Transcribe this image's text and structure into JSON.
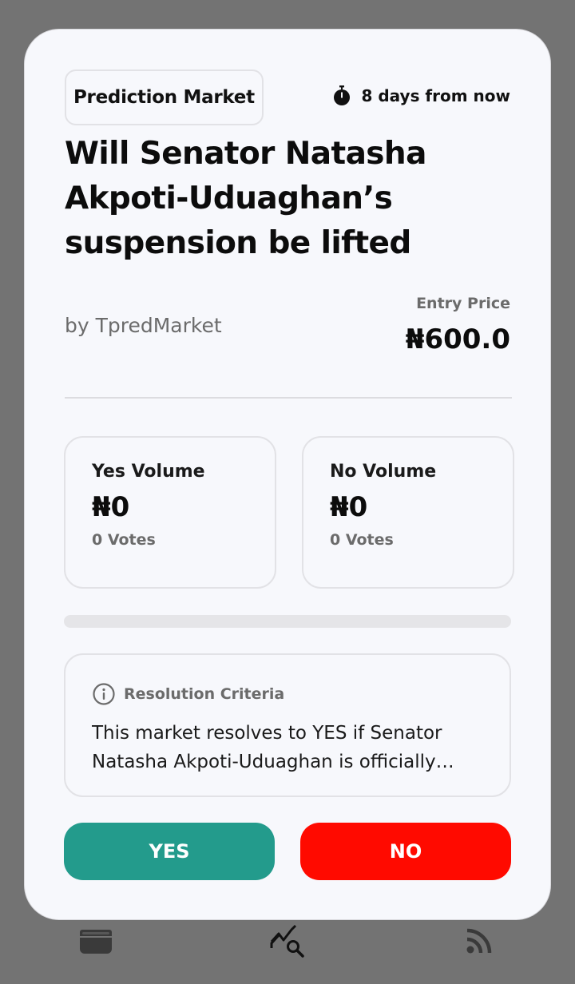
{
  "market": {
    "category": "Prediction Market",
    "deadline": "8 days from now",
    "title": "Will Senator Natasha Akpoti-Uduaghan’s suspension be lifted before",
    "author": "by TpredMarket",
    "entry_label": "Entry Price",
    "entry_value": "₦600.0"
  },
  "volumes": {
    "yes": {
      "label": "Yes Volume",
      "amount": "₦0",
      "votes": "0 Votes"
    },
    "no": {
      "label": "No Volume",
      "amount": "₦0",
      "votes": "0 Votes"
    }
  },
  "progress": {
    "yes_fraction": 0
  },
  "criteria": {
    "label": "Resolution Criteria",
    "text": "This market resolves to YES if Senator Natasha Akpoti-Uduaghan is officially reinstated to the Senate before the deadline."
  },
  "actions": {
    "yes_label": "YES",
    "no_label": "NO"
  },
  "nav": {
    "items": [
      "wallet-icon",
      "market-analysis-icon",
      "rss-feed-icon"
    ]
  },
  "colors": {
    "yes": "#239b8c",
    "no": "#ff0a00",
    "background": "#737373",
    "card": "#f7f8fc"
  }
}
